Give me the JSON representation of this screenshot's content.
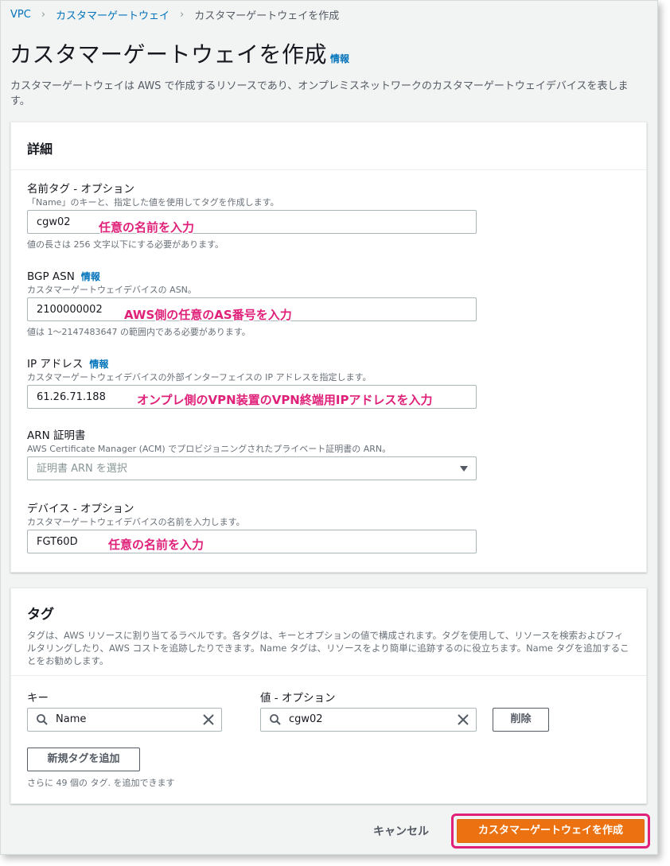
{
  "breadcrumb": {
    "root": "VPC",
    "parent": "カスタマーゲートウェイ",
    "current": "カスタマーゲートウェイを作成"
  },
  "header": {
    "title": "カスタマーゲートウェイを作成",
    "info": "情報",
    "description": "カスタマーゲートウェイは AWS で作成するリソースであり、オンプレミスネットワークのカスタマーゲートウェイデバイスを表します。"
  },
  "details": {
    "title": "詳細",
    "name_tag": {
      "label": "名前タグ - オプション",
      "description": "「Name」のキーと、指定した値を使用してタグを作成します。",
      "value": "cgw02",
      "constraint": "値の長さは 256 文字以下にする必要があります。",
      "annotation": "任意の名前を入力"
    },
    "bgp_asn": {
      "label": "BGP ASN",
      "info": "情報",
      "description": "カスタマーゲートウェイデバイスの ASN。",
      "value": "2100000002",
      "constraint": "値は 1〜2147483647 の範囲内である必要があります。",
      "annotation": "AWS側の任意のAS番号を入力"
    },
    "ip_address": {
      "label": "IP アドレス",
      "info": "情報",
      "description": "カスタマーゲートウェイデバイスの外部インターフェイスの IP アドレスを指定します。",
      "value": "61.26.71.188",
      "annotation": "オンプレ側のVPN装置のVPN終端用IPアドレスを入力"
    },
    "arn_cert": {
      "label": "ARN 証明書",
      "description": "AWS Certificate Manager (ACM) でプロビジョニングされたプライベート証明書の ARN。",
      "placeholder": "証明書 ARN を選択"
    },
    "device": {
      "label": "デバイス - オプション",
      "description": "カスタマーゲートウェイデバイスの名前を入力します。",
      "value": "FGT60D",
      "annotation": "任意の名前を入力"
    }
  },
  "tags": {
    "title": "タグ",
    "description": "タグは、AWS リソースに割り当てるラベルです。各タグは、キーとオプションの値で構成されます。タグを使用して、リソースを検索およびフィルタリングしたり、AWS コストを追跡したりできます。Name タグは、リソースをより簡単に追跡するのに役立ちます。Name タグを追加することをお勧めします。",
    "key_label": "キー",
    "value_label": "値 - オプション",
    "key_value": "Name",
    "value_value": "cgw02",
    "remove_label": "削除",
    "add_label": "新規タグを追加",
    "remaining_hint": "さらに 49 個の タグ. を追加できます"
  },
  "footer": {
    "cancel_label": "キャンセル",
    "create_label": "カスタマーゲートウェイを作成"
  },
  "colors": {
    "link": "#0073bb",
    "primary": "#ec7211",
    "annotation": "#e0217a"
  }
}
